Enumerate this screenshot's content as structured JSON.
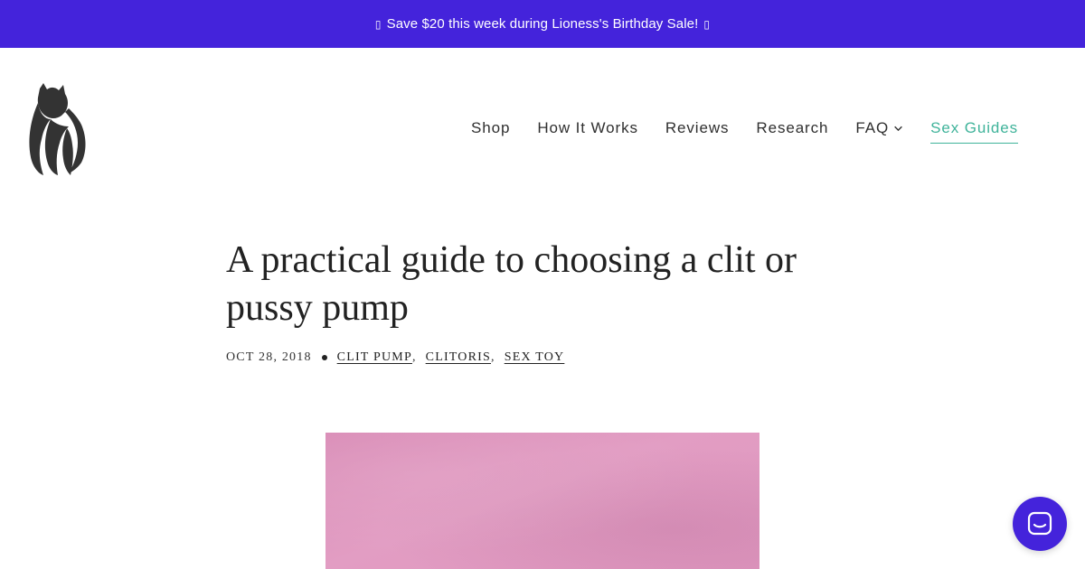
{
  "announcement": {
    "left_icon": "gift-icon",
    "text": "Save $20 this week during Lioness's Birthday Sale!",
    "right_icon": "gift-icon"
  },
  "brand": {
    "logo_icon": "lioness-logo-icon"
  },
  "nav": {
    "items": [
      {
        "label": "Shop"
      },
      {
        "label": "How It Works"
      },
      {
        "label": "Reviews"
      },
      {
        "label": "Research"
      },
      {
        "label": "FAQ",
        "has_dropdown": true
      },
      {
        "label": "Sex Guides",
        "active": true
      }
    ]
  },
  "article": {
    "title": "A practical guide to choosing a clit or pussy pump",
    "date": "OCT 28, 2018",
    "tags": [
      "CLIT PUMP",
      "CLITORIS",
      "SEX TOY"
    ],
    "hero_image": "pink-textured-wall-image"
  },
  "chat_widget": {
    "icon": "chat-bubble-icon"
  },
  "colors": {
    "announcement_bg": "#4423db",
    "accent_active": "#3fb39a",
    "chat_button": "#4423db",
    "hero_pink": "#e29dc3"
  }
}
